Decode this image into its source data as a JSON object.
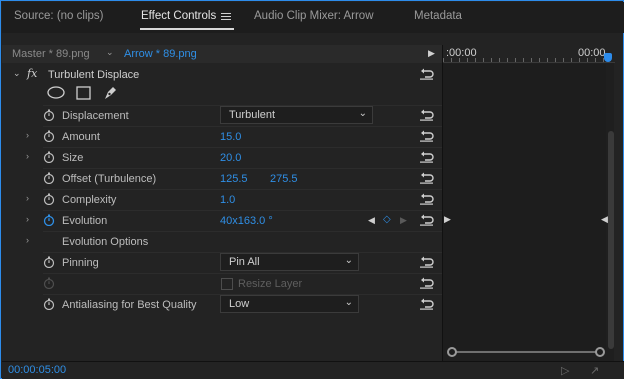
{
  "tabs": [
    {
      "label": "Source: (no clips)",
      "active": false
    },
    {
      "label": "Effect Controls",
      "active": true
    },
    {
      "label": "Audio Clip Mixer: Arrow",
      "active": false
    },
    {
      "label": "Metadata",
      "active": false
    }
  ],
  "source": {
    "master": "Master * 89.png",
    "clip": "Arrow * 89.png"
  },
  "effect": {
    "name": "Turbulent Displace",
    "fx": "fx"
  },
  "properties": {
    "displacement": {
      "label": "Displacement",
      "value": "Turbulent"
    },
    "amount": {
      "label": "Amount",
      "value": "15.0"
    },
    "size": {
      "label": "Size",
      "value": "20.0"
    },
    "offset": {
      "label": "Offset (Turbulence)",
      "x": "125.5",
      "y": "275.5"
    },
    "complexity": {
      "label": "Complexity",
      "value": "1.0"
    },
    "evolution": {
      "label": "Evolution",
      "value": "40x163.0 °"
    },
    "evolution_options": {
      "label": "Evolution Options"
    },
    "pinning": {
      "label": "Pinning",
      "value": "Pin All"
    },
    "resize_layer": {
      "label": "Resize Layer"
    },
    "antialiasing": {
      "label": "Antialiasing for Best Quality",
      "value": "Low"
    }
  },
  "timeline": {
    "start": ":00:00",
    "end": "00:00"
  },
  "footer": {
    "timecode": "00:00:05:00"
  },
  "colors": {
    "accent": "#2f8fe6",
    "border": "#2d8ceb"
  },
  "icons": [
    "stopwatch-icon",
    "reset-icon",
    "ellipse-mask-icon",
    "rectangle-mask-icon",
    "pen-mask-icon",
    "hamburger-icon",
    "filter-icon",
    "export-icon"
  ]
}
